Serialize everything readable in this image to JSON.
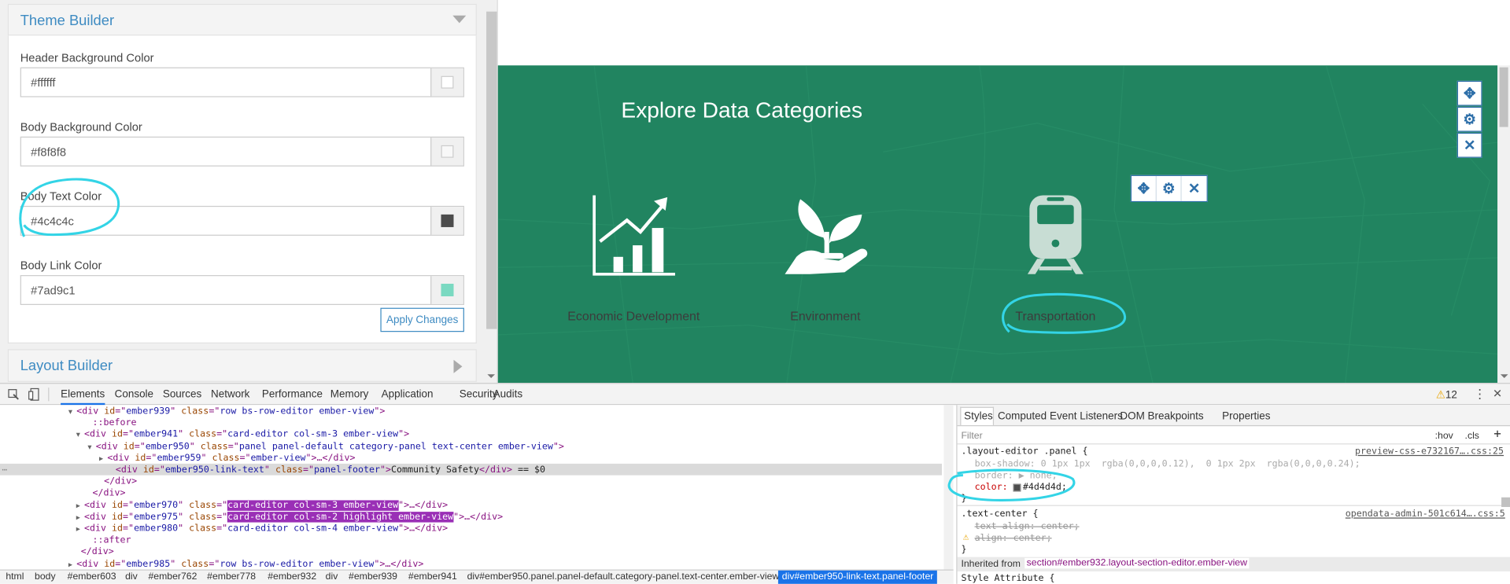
{
  "theme_builder": {
    "title": "Theme Builder",
    "fields": [
      {
        "label": "Header Background Color",
        "value": "#ffffff",
        "swatch": "#ffffff"
      },
      {
        "label": "Body Background Color",
        "value": "#f8f8f8",
        "swatch": "#f8f8f8"
      },
      {
        "label": "Body Text Color",
        "value": "#4c4c4c",
        "swatch": "#4c4c4c"
      },
      {
        "label": "Body Link Color",
        "value": "#7ad9c1",
        "swatch": "#7ad9c1"
      }
    ],
    "apply_label": "Apply Changes"
  },
  "layout_builder": {
    "title": "Layout Builder"
  },
  "preview": {
    "title": "Explore Data Categories",
    "categories": [
      {
        "label": "Economic Development",
        "icon": "chart-growth-icon"
      },
      {
        "label": "Environment",
        "icon": "plant-hand-icon"
      },
      {
        "label": "Transportation",
        "icon": "train-icon"
      }
    ],
    "bg_color": "#218460"
  },
  "devtools": {
    "tabs": [
      "Elements",
      "Console",
      "Sources",
      "Network",
      "Performance",
      "Memory",
      "Application",
      "Security",
      "Audits"
    ],
    "warnings": "12",
    "dom_lines": [
      {
        "indent": 80,
        "arrow": "▼",
        "parts": [
          [
            "tg",
            "<div "
          ],
          [
            "an",
            "id"
          ],
          [
            "tg",
            "=\""
          ],
          [
            "av",
            "ember939"
          ],
          [
            "tg",
            "\" "
          ],
          [
            "an",
            "class"
          ],
          [
            "tg",
            "=\""
          ],
          [
            "av",
            "row bs-row-editor ember-view"
          ],
          [
            "tg",
            "\">"
          ]
        ]
      },
      {
        "indent": 96,
        "arrow": "",
        "parts": [
          [
            "tg",
            "::before"
          ]
        ]
      },
      {
        "indent": 88,
        "arrow": "▼",
        "parts": [
          [
            "tg",
            "<div "
          ],
          [
            "an",
            "id"
          ],
          [
            "tg",
            "=\""
          ],
          [
            "av",
            "ember941"
          ],
          [
            "tg",
            "\" "
          ],
          [
            "an",
            "class"
          ],
          [
            "tg",
            "=\""
          ],
          [
            "av",
            "card-editor col-sm-3 ember-view"
          ],
          [
            "tg",
            "\">"
          ]
        ]
      },
      {
        "indent": 100,
        "arrow": "▼",
        "parts": [
          [
            "tg",
            "<div "
          ],
          [
            "an",
            "id"
          ],
          [
            "tg",
            "=\""
          ],
          [
            "av",
            "ember950"
          ],
          [
            "tg",
            "\" "
          ],
          [
            "an",
            "class"
          ],
          [
            "tg",
            "=\""
          ],
          [
            "av",
            "panel panel-default category-panel text-center ember-view"
          ],
          [
            "tg",
            "\">"
          ]
        ]
      },
      {
        "indent": 112,
        "arrow": "▶",
        "parts": [
          [
            "tg",
            "<div "
          ],
          [
            "an",
            "id"
          ],
          [
            "tg",
            "=\""
          ],
          [
            "av",
            "ember959"
          ],
          [
            "tg",
            "\" "
          ],
          [
            "an",
            "class"
          ],
          [
            "tg",
            "=\""
          ],
          [
            "av",
            "ember-view"
          ],
          [
            "tg",
            "\">…</div>"
          ]
        ]
      },
      {
        "indent": 120,
        "arrow": "",
        "parts": [
          [
            "tg",
            "<div "
          ],
          [
            "an",
            "id"
          ],
          [
            "tg",
            "=\""
          ],
          [
            "av",
            "ember950-link-text"
          ],
          [
            "tg",
            "\" "
          ],
          [
            "an",
            "class"
          ],
          [
            "tg",
            "=\""
          ],
          [
            "av",
            "panel-footer"
          ],
          [
            "tg",
            "\">"
          ],
          [
            "tx",
            "Community Safety"
          ],
          [
            "tg",
            "</div>"
          ],
          [
            "tx",
            " == $0"
          ]
        ]
      },
      {
        "indent": 108,
        "arrow": "",
        "parts": [
          [
            "tg",
            "</div>"
          ]
        ]
      },
      {
        "indent": 96,
        "arrow": "",
        "parts": [
          [
            "tg",
            "</div>"
          ]
        ]
      },
      {
        "indent": 88,
        "arrow": "▶",
        "parts": [
          [
            "tg",
            "<div "
          ],
          [
            "an",
            "id"
          ],
          [
            "tg",
            "=\""
          ],
          [
            "av",
            "ember970"
          ],
          [
            "tg",
            "\" "
          ],
          [
            "an",
            "class"
          ],
          [
            "tg",
            "=\""
          ],
          [
            "hl",
            "card-editor col-sm-3 ember-view"
          ],
          [
            "tg",
            "\">…</div>"
          ]
        ]
      },
      {
        "indent": 88,
        "arrow": "▶",
        "parts": [
          [
            "tg",
            "<div "
          ],
          [
            "an",
            "id"
          ],
          [
            "tg",
            "=\""
          ],
          [
            "av",
            "ember975"
          ],
          [
            "tg",
            "\" "
          ],
          [
            "an",
            "class"
          ],
          [
            "tg",
            "=\""
          ],
          [
            "hl",
            "card-editor col-sm-2 highlight ember-view"
          ],
          [
            "tg",
            "\">…</div>"
          ]
        ]
      },
      {
        "indent": 88,
        "arrow": "▶",
        "parts": [
          [
            "tg",
            "<div "
          ],
          [
            "an",
            "id"
          ],
          [
            "tg",
            "=\""
          ],
          [
            "av",
            "ember980"
          ],
          [
            "tg",
            "\" "
          ],
          [
            "an",
            "class"
          ],
          [
            "tg",
            "=\""
          ],
          [
            "av",
            "card-editor col-sm-4 ember-view"
          ],
          [
            "tg",
            "\">…</div>"
          ]
        ]
      },
      {
        "indent": 96,
        "arrow": "",
        "parts": [
          [
            "tg",
            "::after"
          ]
        ]
      },
      {
        "indent": 84,
        "arrow": "",
        "parts": [
          [
            "tg",
            "</div>"
          ]
        ]
      },
      {
        "indent": 80,
        "arrow": "▶",
        "parts": [
          [
            "tg",
            "<div "
          ],
          [
            "an",
            "id"
          ],
          [
            "tg",
            "=\""
          ],
          [
            "av",
            "ember985"
          ],
          [
            "tg",
            "\" "
          ],
          [
            "an",
            "class"
          ],
          [
            "tg",
            "=\""
          ],
          [
            "av",
            "row bs-row-editor ember-view"
          ],
          [
            "tg",
            "\">…</div>"
          ]
        ]
      }
    ],
    "breadcrumb": [
      "html",
      "body",
      "#ember603",
      "div",
      "#ember762",
      "#ember778",
      "#ember932",
      "div",
      "#ember939",
      "#ember941",
      "div#ember950.panel.panel-default.category-panel.text-center.ember-view",
      "div#ember950-link-text.panel-footer"
    ],
    "styles_tabs": [
      "Styles",
      "Computed",
      "Event Listeners",
      "DOM Breakpoints",
      "Properties"
    ],
    "filter_placeholder": "Filter",
    "hov": ":hov",
    "cls": ".cls",
    "rule1_selector": ".layout-editor .panel {",
    "rule1_source": "preview-css-e732167….css:25",
    "rule1_box_shadow": "box-shadow: ",
    "rule1_box_shadow_val": "0 1px 1px  rgba(0,0,0,0.12),  0 1px 2px  rgba(0,0,0,0.24);",
    "rule1_border": "border: ▶ none;",
    "rule1_color_prop": "color: ",
    "rule1_color_val": "#4d4d4d;",
    "rule2_selector": ".text-center {",
    "rule2_source": "opendata-admin-501c614….css:5",
    "rule2_text_align": "text-align: center;",
    "rule2_align": "align: center;",
    "inherited_label": "Inherited from",
    "inherited_from": "section#ember932.layout-section-editor.ember-view",
    "style_attribute": "Style Attribute {"
  }
}
